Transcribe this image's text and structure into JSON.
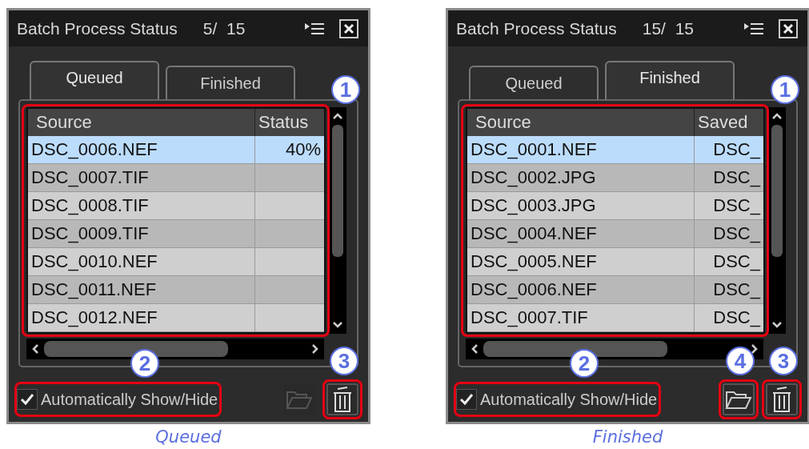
{
  "panels": [
    {
      "title": "Batch Process Status",
      "counter": "5/  15",
      "tabs": [
        {
          "label": "Queued",
          "selected": true
        },
        {
          "label": "Finished",
          "selected": false
        }
      ],
      "columns": [
        "Source",
        "Status"
      ],
      "rows": [
        {
          "cells": [
            "DSC_0006.NEF",
            "40%"
          ],
          "selected": true
        },
        {
          "cells": [
            "DSC_0007.TIF"
          ],
          "selected": false
        },
        {
          "cells": [
            "DSC_0008.TIF"
          ],
          "selected": false
        },
        {
          "cells": [
            "DSC_0009.TIF"
          ],
          "selected": false
        },
        {
          "cells": [
            "DSC_0010.NEF"
          ],
          "selected": false
        },
        {
          "cells": [
            "DSC_0011.NEF"
          ],
          "selected": false
        },
        {
          "cells": [
            "DSC_0012.NEF"
          ],
          "selected": false
        }
      ],
      "table_callout": "1",
      "auto_show_hide": {
        "label": "Automatically Show/Hide",
        "checked": true,
        "callout": "2"
      },
      "folder_button": {
        "disabled": true
      },
      "delete_button": {
        "callout": "3"
      },
      "caption": "Queued"
    },
    {
      "title": "Batch Process Status",
      "counter": "15/  15",
      "tabs": [
        {
          "label": "Queued",
          "selected": false
        },
        {
          "label": "Finished",
          "selected": true
        }
      ],
      "columns": [
        "Source",
        "Saved"
      ],
      "rows": [
        {
          "cells": [
            "DSC_0001.NEF",
            "DSC_"
          ],
          "selected": true
        },
        {
          "cells": [
            "DSC_0002.JPG",
            "DSC_"
          ],
          "selected": false
        },
        {
          "cells": [
            "DSC_0003.JPG",
            "DSC_"
          ],
          "selected": false
        },
        {
          "cells": [
            "DSC_0004.NEF",
            "DSC_"
          ],
          "selected": false
        },
        {
          "cells": [
            "DSC_0005.NEF",
            "DSC_"
          ],
          "selected": false
        },
        {
          "cells": [
            "DSC_0006.NEF",
            "DSC_"
          ],
          "selected": false
        },
        {
          "cells": [
            "DSC_0007.TIF",
            "DSC_"
          ],
          "selected": false
        }
      ],
      "table_callout": "1",
      "auto_show_hide": {
        "label": "Automatically Show/Hide",
        "checked": true,
        "callout": "2"
      },
      "folder_button": {
        "disabled": false,
        "callout": "4"
      },
      "delete_button": {
        "callout": "3"
      },
      "caption": "Finished"
    }
  ]
}
